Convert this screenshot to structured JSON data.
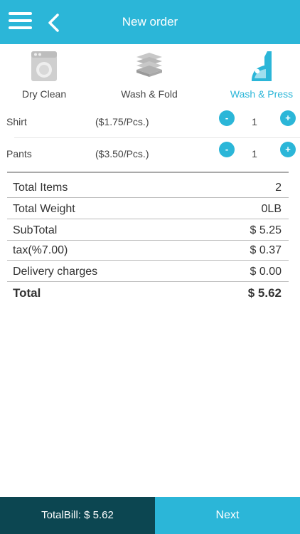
{
  "header": {
    "title": "New order"
  },
  "services": [
    {
      "label": "Dry Clean",
      "icon": "washing-machine-icon",
      "active": false
    },
    {
      "label": "Wash & Fold",
      "icon": "folded-clothes-icon",
      "active": false
    },
    {
      "label": "Wash & Press",
      "icon": "iron-icon",
      "active": true
    }
  ],
  "items": [
    {
      "name": "Shirt",
      "price": "($1.75/Pcs.)",
      "qty": "1"
    },
    {
      "name": "Pants",
      "price": "($3.50/Pcs.)",
      "qty": "1"
    }
  ],
  "summary": {
    "total_items_label": "Total  Items",
    "total_items_value": "2",
    "total_weight_label": "Total Weight",
    "total_weight_value": "0LB",
    "subtotal_label": "SubTotal",
    "subtotal_value": "$ 5.25",
    "tax_label": "tax(%7.00)",
    "tax_value": "$ 0.37",
    "delivery_label": "Delivery charges",
    "delivery_value": "$ 0.00",
    "total_label": "Total",
    "total_value": "$ 5.62"
  },
  "footer": {
    "total_bill": "TotalBill: $ 5.62",
    "next_label": "Next"
  },
  "colors": {
    "accent": "#2bb6d8",
    "dark": "#0c4651"
  }
}
